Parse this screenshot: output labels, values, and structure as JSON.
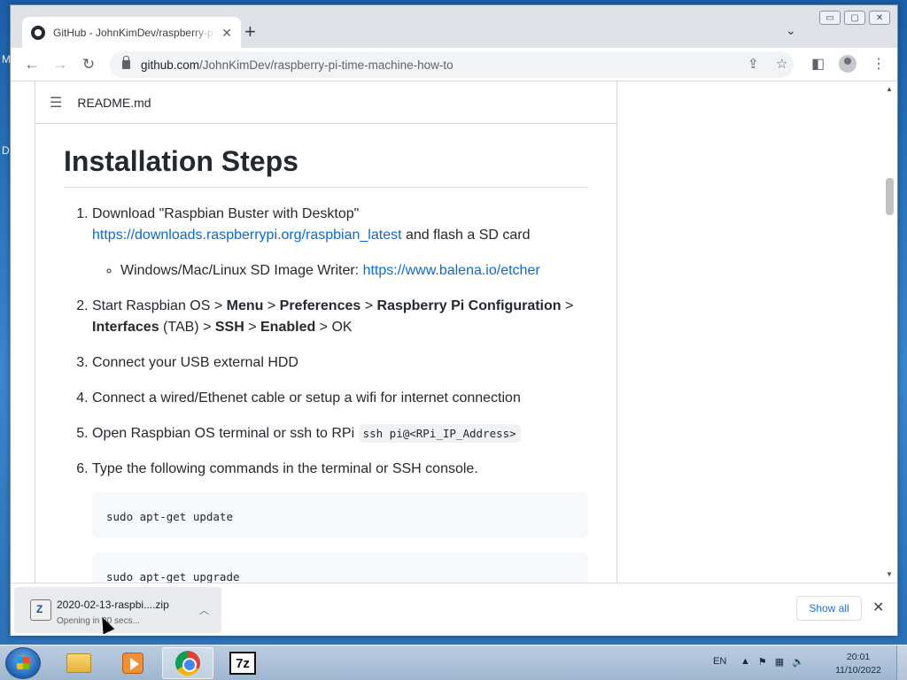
{
  "desktop": {
    "letters": [
      "M",
      "D"
    ]
  },
  "browser": {
    "tab_title": "GitHub - JohnKimDev/raspberry-pi-time-machine-how-to",
    "tab_close": "✕",
    "new_tab": "+",
    "url_host": "github.com",
    "url_path": "/JohnKimDev/raspberry-pi-time-machine-how-to",
    "window_controls": {
      "minimize": "▭",
      "maximize": "▢",
      "close": "✕"
    }
  },
  "readme": {
    "filename": "README.md",
    "heading": "Installation Steps",
    "steps": {
      "s1_text": "Download \"Raspbian Buster with Desktop\"",
      "s1_link": "https://downloads.raspberrypi.org/raspbian_latest",
      "s1_tail": " and flash a SD card",
      "s1_sub_text": "Windows/Mac/Linux SD Image Writer: ",
      "s1_sub_link": "https://www.balena.io/etcher",
      "s2_a": "Start Raspbian OS > ",
      "s2_menu": "Menu",
      "s2_sep": " > ",
      "s2_prefs": "Preferences",
      "s2_config": "Raspberry Pi Configuration",
      "s2_interfaces": "Interfaces",
      "s2_tab": " (TAB) > ",
      "s2_ssh": "SSH",
      "s2_enabled": "Enabled",
      "s2_ok": " > OK",
      "s3": "Connect your USB external HDD",
      "s4": "Connect a wired/Ethenet cable or setup a wifi for internet connection",
      "s5_text": "Open Raspbian OS terminal or ssh to RPi ",
      "s5_code": "ssh pi@<RPi_IP_Address>",
      "s6": "Type the following commands in the terminal or SSH console."
    },
    "code_blocks": [
      "sudo apt-get update",
      "sudo apt-get upgrade"
    ]
  },
  "download_shelf": {
    "filename": "2020-02-13-raspbi....zip",
    "status": "Opening in 20 secs...",
    "show_all": "Show all"
  },
  "taskbar": {
    "language": "EN",
    "time": "20:01",
    "date": "11/10/2022",
    "active_app": "chrome"
  }
}
